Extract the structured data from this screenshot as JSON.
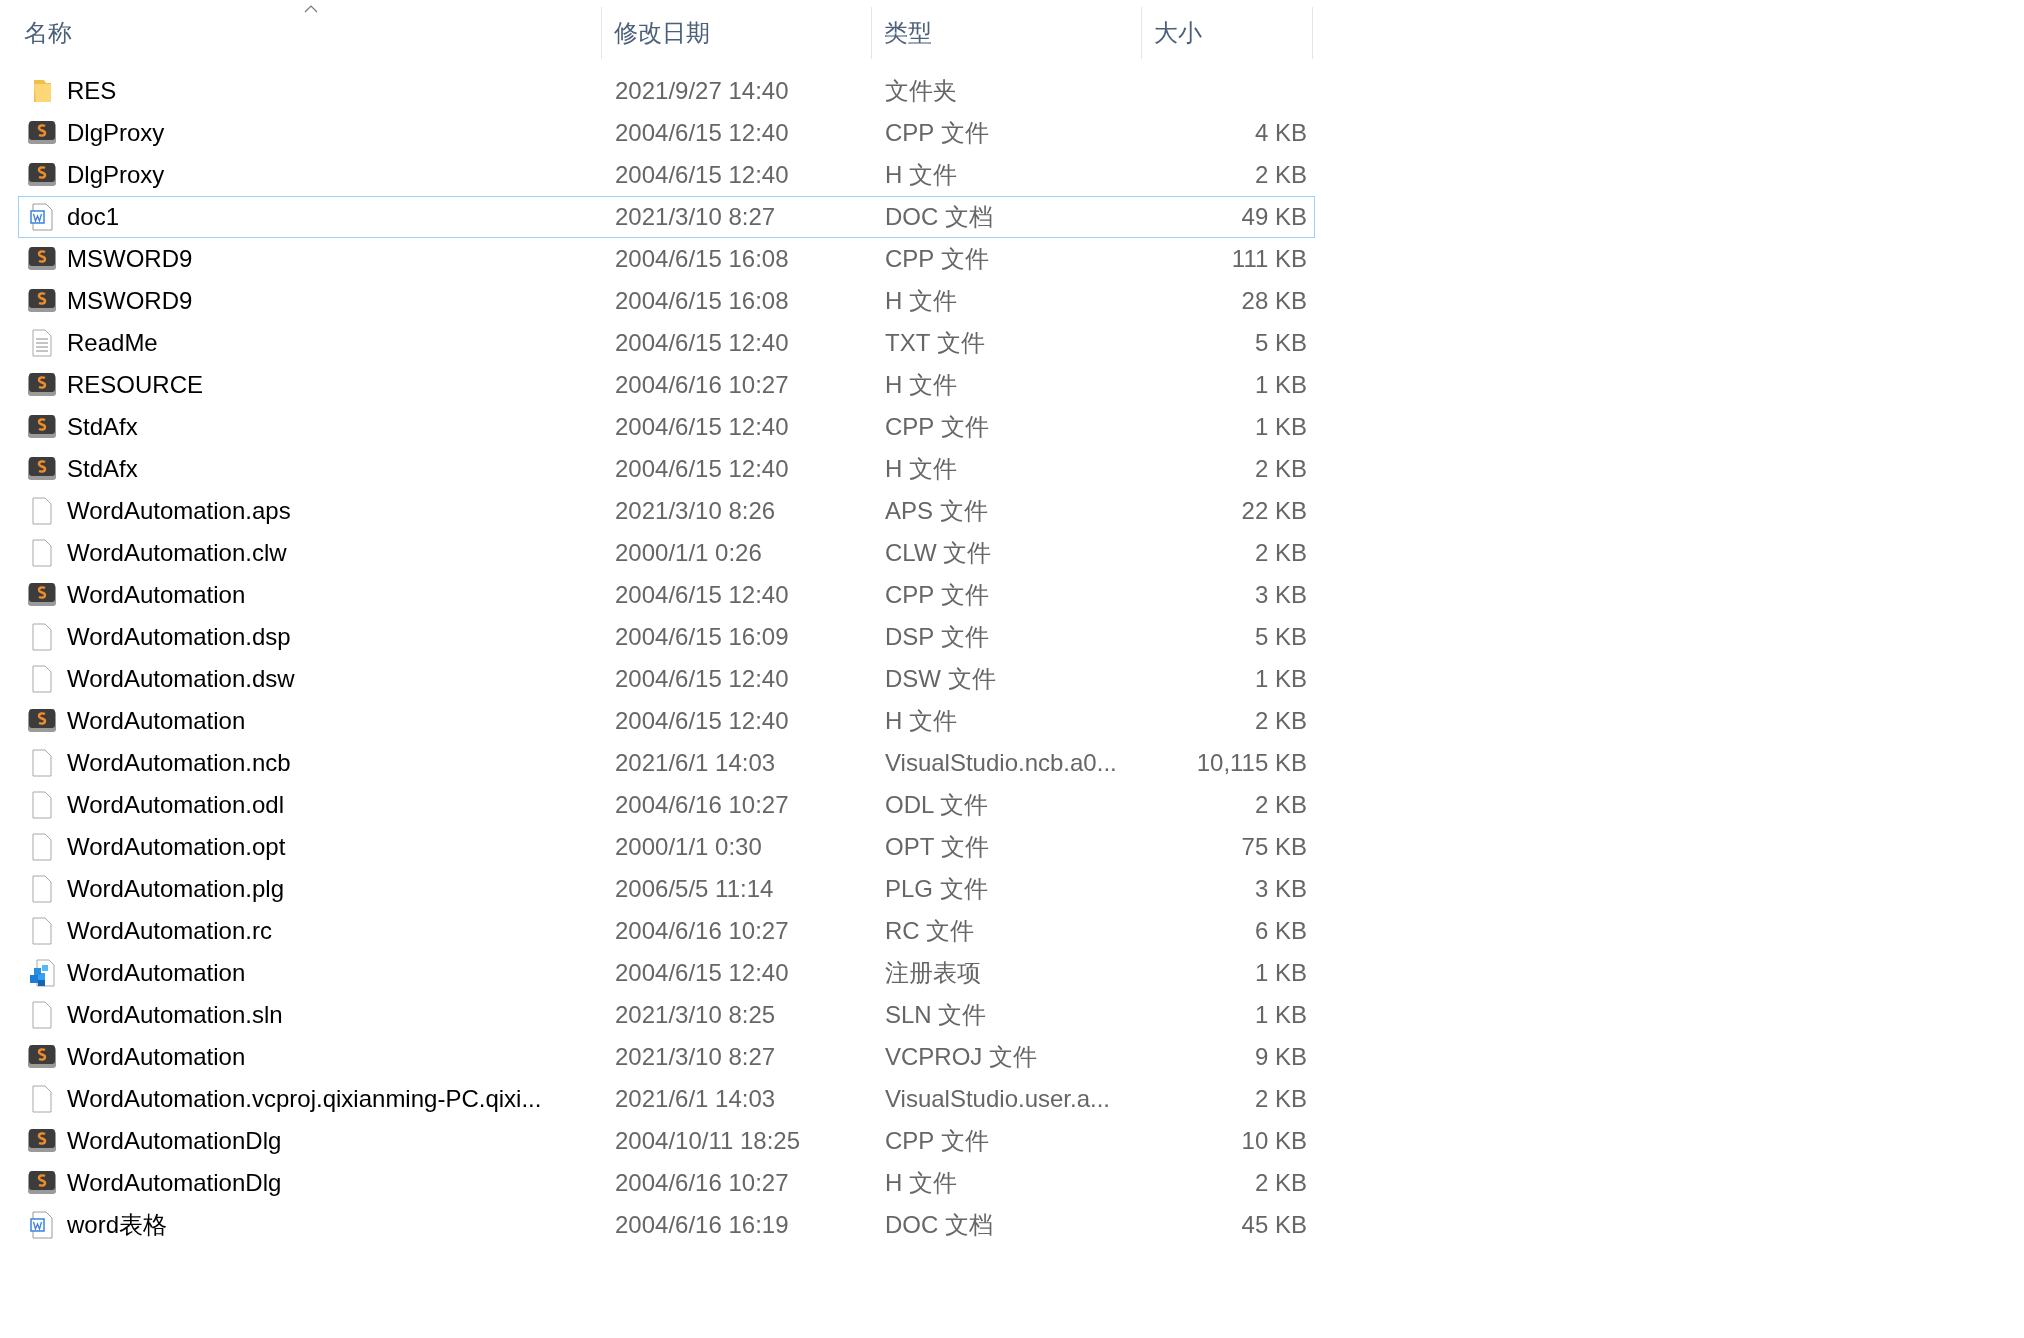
{
  "columns": [
    {
      "label": "名称",
      "sorted": true
    },
    {
      "label": "修改日期",
      "sorted": false
    },
    {
      "label": "类型",
      "sorted": false
    },
    {
      "label": "大小",
      "sorted": false
    }
  ],
  "files": [
    {
      "kind": "folder",
      "name": "RES",
      "modified": "2021/9/27 14:40",
      "type": "文件夹",
      "focused": false
    },
    {
      "kind": "source",
      "name": "DlgProxy",
      "modified": "2004/6/15 12:40",
      "type": "CPP 文件",
      "size": "4 KB",
      "focused": false
    },
    {
      "kind": "source",
      "name": "DlgProxy",
      "modified": "2004/6/15 12:40",
      "type": "H 文件",
      "size": "2 KB",
      "focused": false
    },
    {
      "kind": "word",
      "name": "doc1",
      "modified": "2021/3/10 8:27",
      "type": "DOC 文档",
      "size": "49 KB",
      "focused": true
    },
    {
      "kind": "source",
      "name": "MSWORD9",
      "modified": "2004/6/15 16:08",
      "type": "CPP 文件",
      "size": "111 KB",
      "focused": false
    },
    {
      "kind": "source",
      "name": "MSWORD9",
      "modified": "2004/6/15 16:08",
      "type": "H 文件",
      "size": "28 KB",
      "focused": false
    },
    {
      "kind": "text",
      "name": "ReadMe",
      "modified": "2004/6/15 12:40",
      "type": "TXT 文件",
      "size": "5 KB",
      "focused": false
    },
    {
      "kind": "source",
      "name": "RESOURCE",
      "modified": "2004/6/16 10:27",
      "type": "H 文件",
      "size": "1 KB",
      "focused": false
    },
    {
      "kind": "source",
      "name": "StdAfx",
      "modified": "2004/6/15 12:40",
      "type": "CPP 文件",
      "size": "1 KB",
      "focused": false
    },
    {
      "kind": "source",
      "name": "StdAfx",
      "modified": "2004/6/15 12:40",
      "type": "H 文件",
      "size": "2 KB",
      "focused": false
    },
    {
      "kind": "blank",
      "name": "WordAutomation.aps",
      "modified": "2021/3/10 8:26",
      "type": "APS 文件",
      "size": "22 KB",
      "focused": false
    },
    {
      "kind": "blank",
      "name": "WordAutomation.clw",
      "modified": "2000/1/1 0:26",
      "type": "CLW 文件",
      "size": "2 KB",
      "focused": false
    },
    {
      "kind": "source",
      "name": "WordAutomation",
      "modified": "2004/6/15 12:40",
      "type": "CPP 文件",
      "size": "3 KB",
      "focused": false
    },
    {
      "kind": "blank",
      "name": "WordAutomation.dsp",
      "modified": "2004/6/15 16:09",
      "type": "DSP 文件",
      "size": "5 KB",
      "focused": false
    },
    {
      "kind": "blank",
      "name": "WordAutomation.dsw",
      "modified": "2004/6/15 12:40",
      "type": "DSW 文件",
      "size": "1 KB",
      "focused": false
    },
    {
      "kind": "source",
      "name": "WordAutomation",
      "modified": "2004/6/15 12:40",
      "type": "H 文件",
      "size": "2 KB",
      "focused": false
    },
    {
      "kind": "blank",
      "name": "WordAutomation.ncb",
      "modified": "2021/6/1 14:03",
      "type": "VisualStudio.ncb.a0...",
      "size": "10,115 KB",
      "focused": false
    },
    {
      "kind": "blank",
      "name": "WordAutomation.odl",
      "modified": "2004/6/16 10:27",
      "type": "ODL 文件",
      "size": "2 KB",
      "focused": false
    },
    {
      "kind": "blank",
      "name": "WordAutomation.opt",
      "modified": "2000/1/1 0:30",
      "type": "OPT 文件",
      "size": "75 KB",
      "focused": false
    },
    {
      "kind": "blank",
      "name": "WordAutomation.plg",
      "modified": "2006/5/5 11:14",
      "type": "PLG 文件",
      "size": "3 KB",
      "focused": false
    },
    {
      "kind": "blank",
      "name": "WordAutomation.rc",
      "modified": "2004/6/16 10:27",
      "type": "RC 文件",
      "size": "6 KB",
      "focused": false
    },
    {
      "kind": "registry",
      "name": "WordAutomation",
      "modified": "2004/6/15 12:40",
      "type": "注册表项",
      "size": "1 KB",
      "focused": false
    },
    {
      "kind": "blank",
      "name": "WordAutomation.sln",
      "modified": "2021/3/10 8:25",
      "type": "SLN 文件",
      "size": "1 KB",
      "focused": false
    },
    {
      "kind": "source",
      "name": "WordAutomation",
      "modified": "2021/3/10 8:27",
      "type": "VCPROJ 文件",
      "size": "9 KB",
      "focused": false
    },
    {
      "kind": "blank",
      "name": "WordAutomation.vcproj.qixianming-PC.qixi...",
      "modified": "2021/6/1 14:03",
      "type": "VisualStudio.user.a...",
      "size": "2 KB",
      "focused": false
    },
    {
      "kind": "source",
      "name": "WordAutomationDlg",
      "modified": "2004/10/11 18:25",
      "type": "CPP 文件",
      "size": "10 KB",
      "focused": false
    },
    {
      "kind": "source",
      "name": "WordAutomationDlg",
      "modified": "2004/6/16 10:27",
      "type": "H 文件",
      "size": "2 KB",
      "focused": false
    },
    {
      "kind": "word",
      "name": "word表格",
      "modified": "2004/6/16 16:19",
      "type": "DOC 文档",
      "size": "45 KB",
      "focused": false
    }
  ]
}
